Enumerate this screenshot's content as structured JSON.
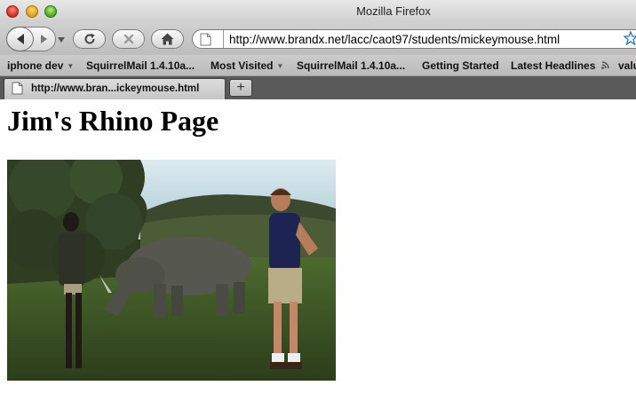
{
  "window": {
    "title": "Mozilla Firefox"
  },
  "toolbar": {
    "url": "http://www.brandx.net/lacc/caot97/students/mickeymouse.html"
  },
  "bookmarks": [
    {
      "label": "iphone dev",
      "dropdown": true
    },
    {
      "label": "SquirrelMail 1.4.10a...",
      "dropdown": false
    },
    {
      "label": "Most Visited",
      "dropdown": true
    },
    {
      "label": "SquirrelMail 1.4.10a...",
      "dropdown": false
    },
    {
      "label": "Getting Started",
      "dropdown": false
    },
    {
      "label": "Latest Headlines",
      "dropdown": false,
      "icon": "rss-icon"
    },
    {
      "label": "valu",
      "dropdown": false
    }
  ],
  "tabs": [
    {
      "label": "http://www.bran...ickeymouse.html",
      "active": true
    }
  ],
  "new_tab_label": "+",
  "page": {
    "heading": "Jim's Rhino Page"
  },
  "colors": {
    "link": "#0000ee",
    "sky": "#b8d3de",
    "grass": "#3d5a26"
  }
}
